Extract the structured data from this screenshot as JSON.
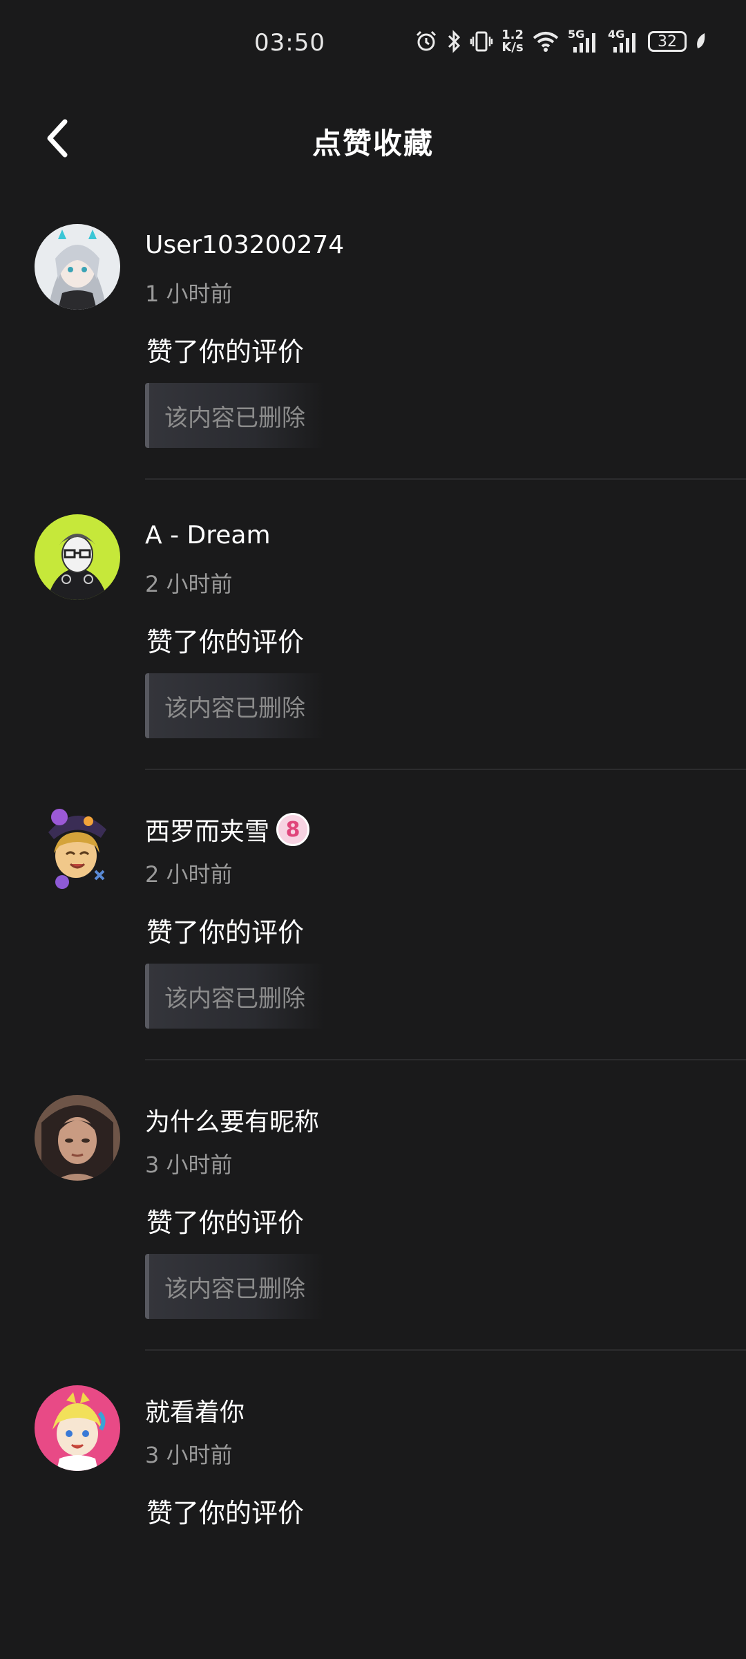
{
  "status_bar": {
    "time": "03:50",
    "speed_top": "1.2",
    "speed_bottom": "K/s",
    "net1": "5G",
    "net2": "4G",
    "battery": "32",
    "icons": [
      "alarm-icon",
      "bluetooth-icon",
      "vibrate-icon",
      "wifi-icon",
      "signal-icon",
      "battery-icon",
      "leaf-icon"
    ]
  },
  "header": {
    "title": "点赞收藏",
    "back_icon": "chevron-left-icon"
  },
  "items": [
    {
      "username": "User103200274",
      "time": "1 小时前",
      "action": "赞了你的评价",
      "content": "该内容已删除",
      "avatar": "avatar-anime-girl-silver",
      "badge": ""
    },
    {
      "username": "A - Dream",
      "time": "2 小时前",
      "action": "赞了你的评价",
      "content": "该内容已删除",
      "avatar": "avatar-glasses-boy-lime",
      "badge": ""
    },
    {
      "username": "西罗而夹雪",
      "time": "2 小时前",
      "action": "赞了你的评价",
      "content": "该内容已删除",
      "avatar": "avatar-witch-hat",
      "badge": "8"
    },
    {
      "username": "为什么要有昵称",
      "time": "3 小时前",
      "action": "赞了你的评价",
      "content": "该内容已删除",
      "avatar": "avatar-dark-hair",
      "badge": ""
    },
    {
      "username": "就看着你",
      "time": "3 小时前",
      "action": "赞了你的评价",
      "content": "",
      "avatar": "avatar-pink-bg",
      "badge": ""
    }
  ]
}
